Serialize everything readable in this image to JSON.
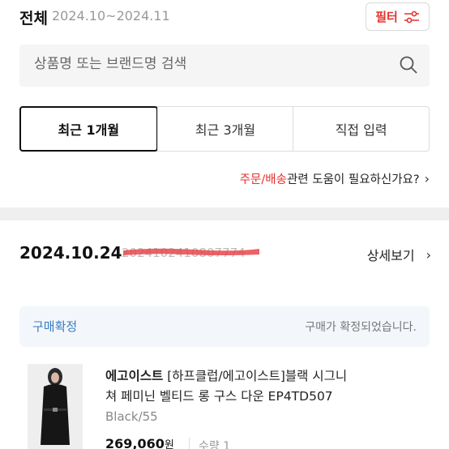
{
  "header": {
    "title": "전체",
    "period": "2024.10~2024.11",
    "filter_label": "필터",
    "filter_icon": "sliders-icon"
  },
  "search": {
    "placeholder": "상품명 또는 브랜드명 검색",
    "icon": "search-icon"
  },
  "tabs": [
    {
      "label": "최근 1개월",
      "active": true
    },
    {
      "label": "최근 3개월",
      "active": false
    },
    {
      "label": "직접 입력",
      "active": false
    }
  ],
  "help": {
    "accent": "주문/배송",
    "text": "관련 도움이 필요하신가요?",
    "icon": "chevron-right-icon"
  },
  "order": {
    "date": "2024.10.24",
    "number_partial": "2024102410807774",
    "detail_label": "상세보기",
    "detail_icon": "chevron-right-icon",
    "status": "구매확정",
    "status_message": "구매가 확정되었습니다."
  },
  "product": {
    "brand": "에고이스트",
    "name_line1": "[하프클럽/에고이스트]블랙 시그니",
    "name_line2": "쳐 페미닌 벨티드 롱 구스 다운 EP4TD507",
    "option": "Black/55",
    "price": "269,060",
    "currency": "원",
    "quantity": "수량 1"
  },
  "colors": {
    "accent": "#e5322d",
    "status_blue": "#3a7cc4",
    "status_bg": "#f3f7fb"
  }
}
